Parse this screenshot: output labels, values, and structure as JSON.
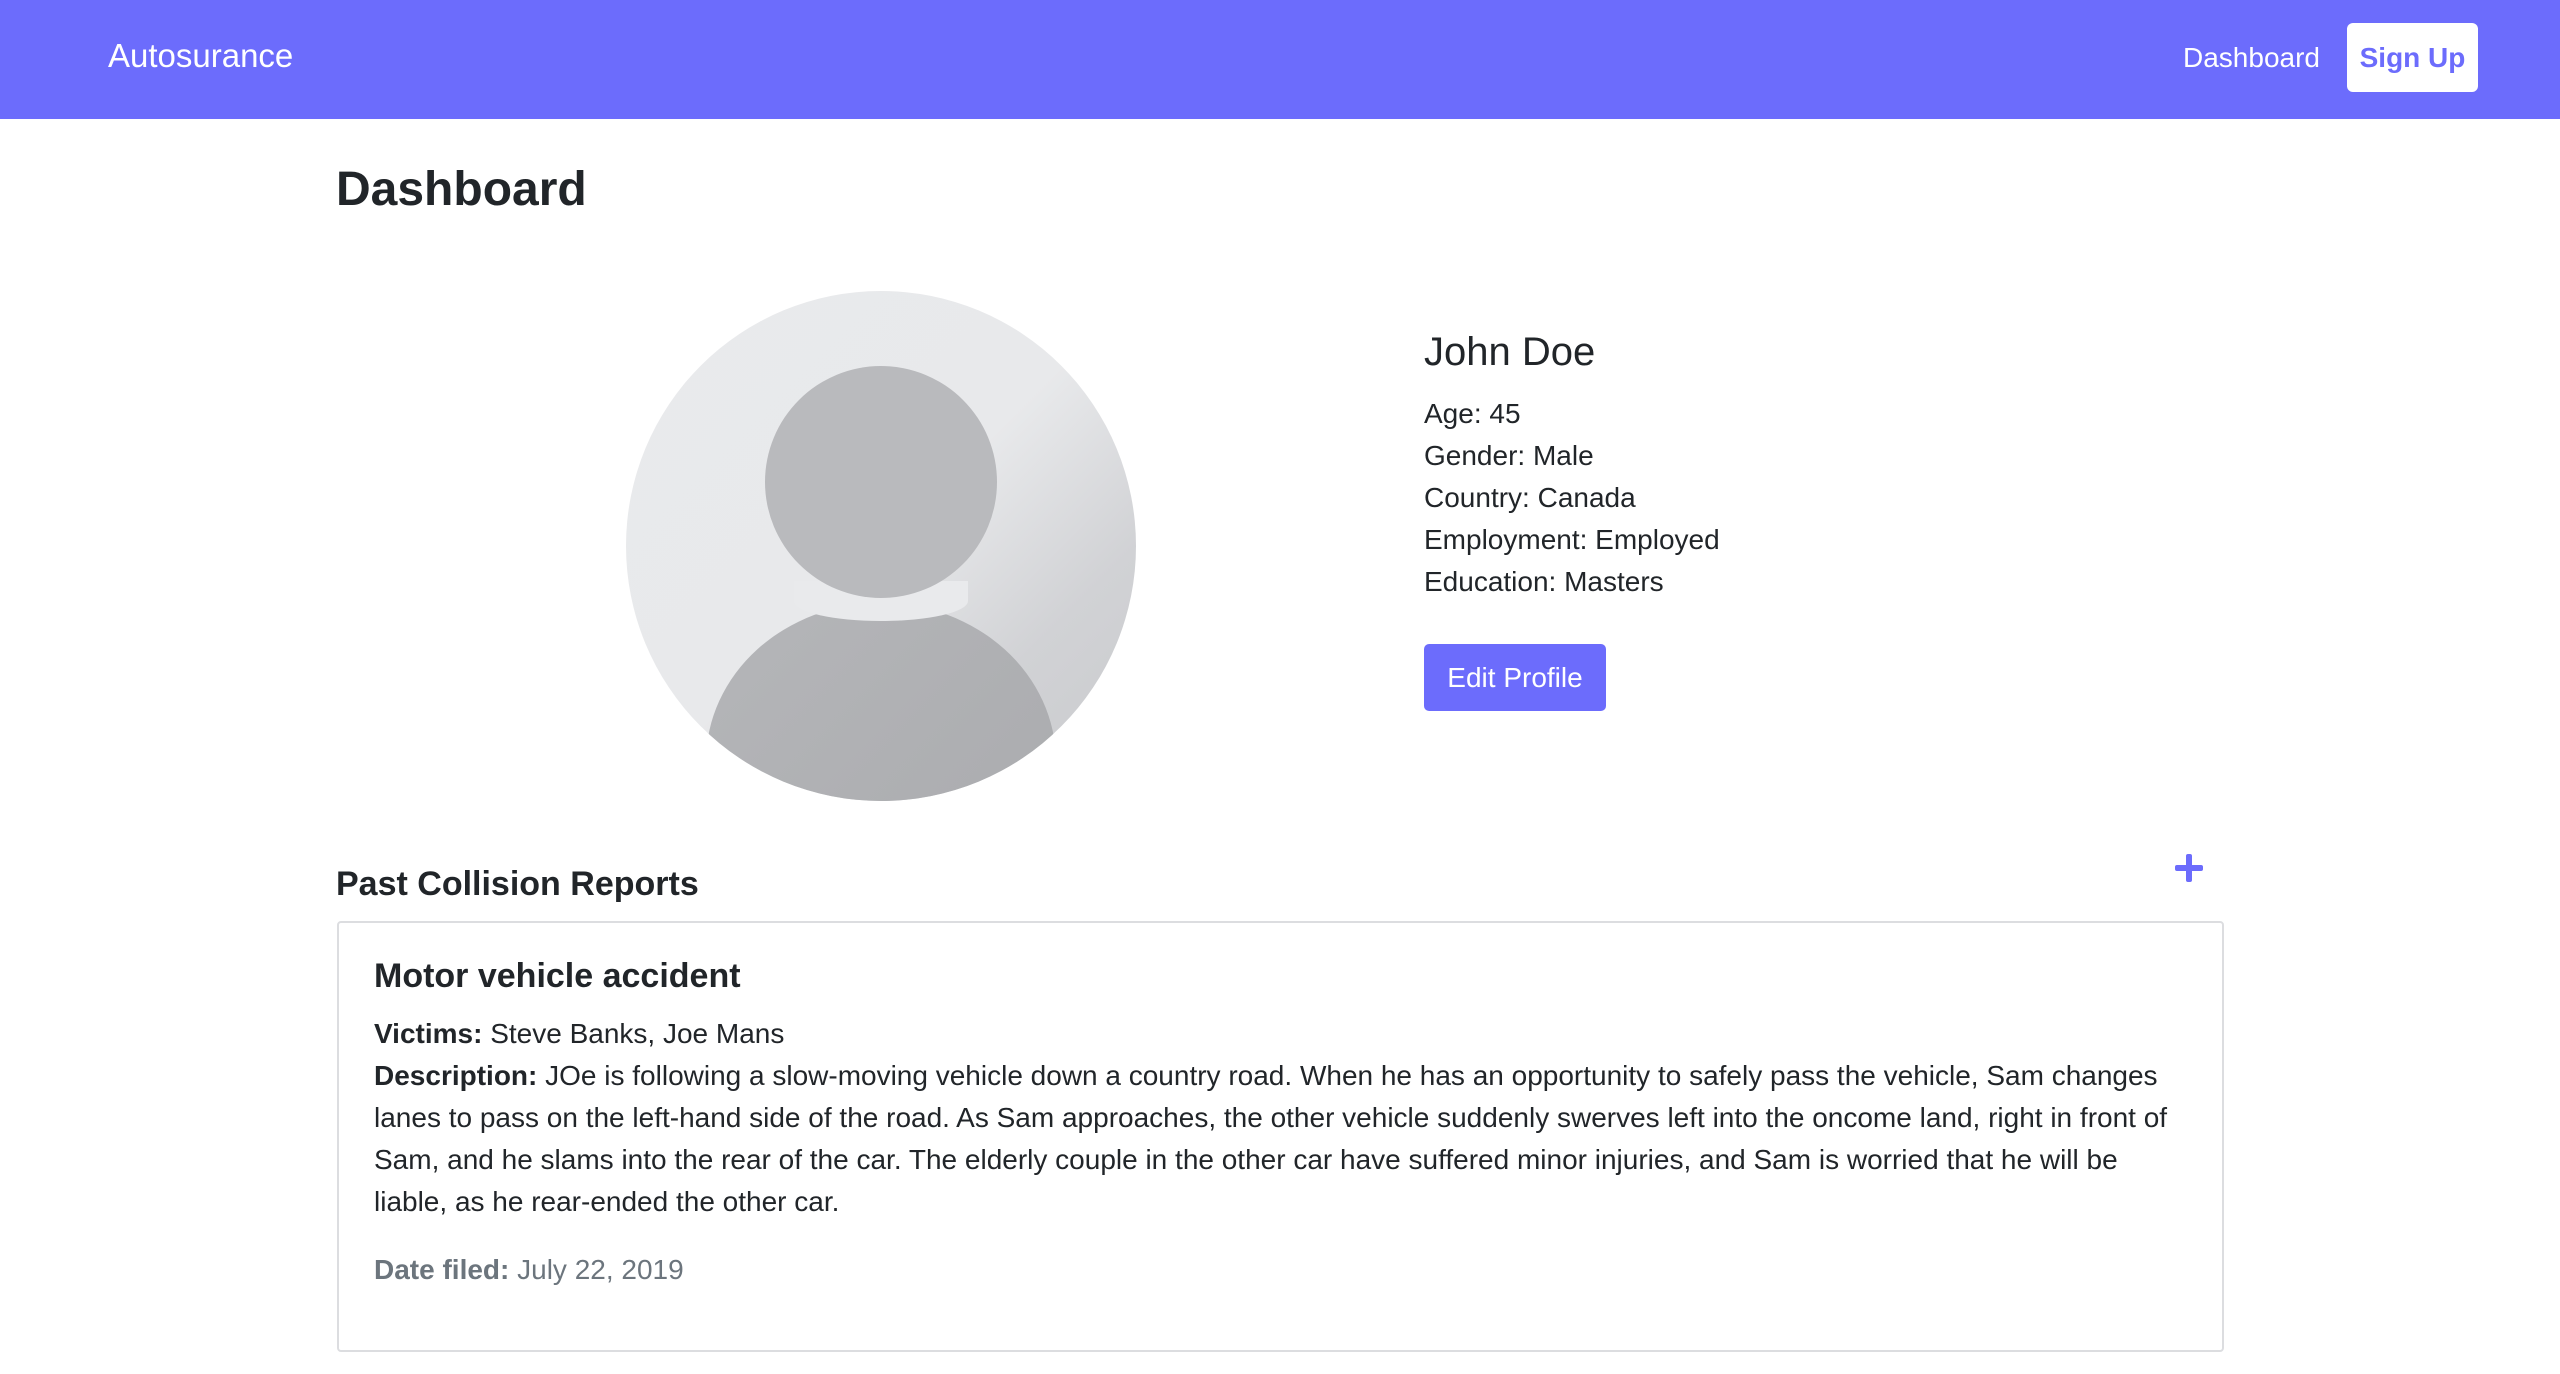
{
  "navbar": {
    "brand": "Autosurance",
    "dashboard_link": "Dashboard",
    "signup_label": "Sign Up"
  },
  "page": {
    "title": "Dashboard"
  },
  "profile": {
    "name": "John Doe",
    "fields": [
      "Age: 45",
      "Gender: Male",
      "Country: Canada",
      "Employment: Employed",
      "Education: Masters"
    ],
    "edit_label": "Edit Profile"
  },
  "reports": {
    "section_title": "Past Collision Reports",
    "add_icon": "plus-icon",
    "items": [
      {
        "title": "Motor vehicle accident",
        "victims_label": "Victims:",
        "victims": "Steve Banks, Joe Mans",
        "description_label": "Description:",
        "description": "JOe is following a slow-moving vehicle down a country road. When he has an opportunity to safely pass the vehicle, Sam changes lanes to pass on the left-hand side of the road. As Sam approaches, the other vehicle suddenly swerves left into the oncome land, right in front of Sam, and he slams into the rear of the car. The elderly couple in the other car have suffered minor injuries, and Sam is worried that he will be liable, as he rear-ended the other car.",
        "date_label": "Date filed:",
        "date": "July 22, 2019"
      }
    ]
  },
  "colors": {
    "primary": "#6c6cfc",
    "text": "#212529",
    "muted": "#6c757d",
    "border": "#dcdde0"
  }
}
